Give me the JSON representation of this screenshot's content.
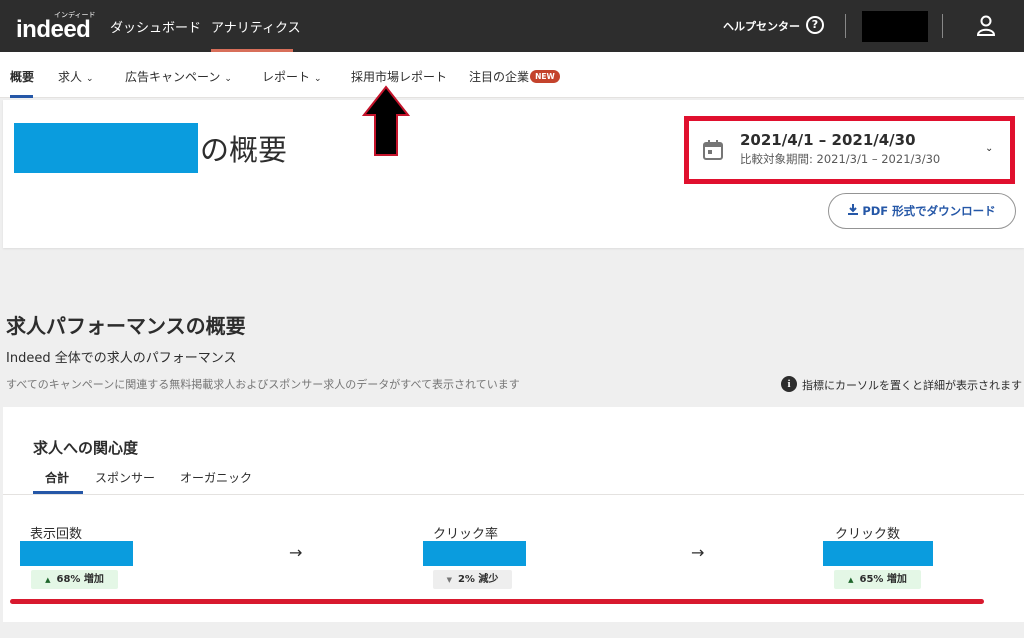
{
  "brand": {
    "logo_text": "indeed",
    "logo_kana": "インディード"
  },
  "topnav": {
    "dashboard": "ダッシュボード",
    "analytics": "アナリティクス",
    "help": "ヘルプセンター",
    "help_icon": "?"
  },
  "subnav": {
    "overview": "概要",
    "jobs": "求人",
    "campaigns": "広告キャンペーン",
    "reports": "レポート",
    "hiring_market": "採用市場レポート",
    "featured_companies": "注目の企業",
    "new_badge": "NEW",
    "chevron": "⌄"
  },
  "header": {
    "title_suffix": "の概要",
    "date_range": "2021/4/1 – 2021/4/30",
    "compare_range": "比較対象期間: 2021/3/1 – 2021/3/30",
    "pdf_button": "PDF 形式でダウンロード"
  },
  "section": {
    "title": "求人パフォーマンスの概要",
    "subtitle": "Indeed 全体での求人のパフォーマンス",
    "note": "すべてのキャンペーンに関連する無料掲載求人およびスポンサー求人のデータがすべて表示されています",
    "info_icon": "i",
    "hint": "指標にカーソルを置くと詳細が表示されます"
  },
  "interest": {
    "title": "求人への関心度",
    "tabs": [
      "合計",
      "スポンサー",
      "オーガニック"
    ],
    "arrow": "→",
    "metrics": [
      {
        "label": "表示回数",
        "change": "68% 増加",
        "direction": "up"
      },
      {
        "label": "クリック率",
        "change": "2% 減少",
        "direction": "down"
      },
      {
        "label": "クリック数",
        "change": "65% 増加",
        "direction": "up"
      }
    ],
    "up_symbol": "▲",
    "down_symbol": "▼"
  },
  "colors": {
    "topbar": "#2d2d2d",
    "accent_blue": "#2557a7",
    "redaction_blue": "#0a9cde",
    "annotation_red": "#e0102e",
    "new_badge": "#c4432c"
  },
  "icons": [
    "user-icon",
    "calendar-icon",
    "download-icon",
    "info-icon",
    "help-icon",
    "chevron-down-icon",
    "arrow-right-icon"
  ]
}
